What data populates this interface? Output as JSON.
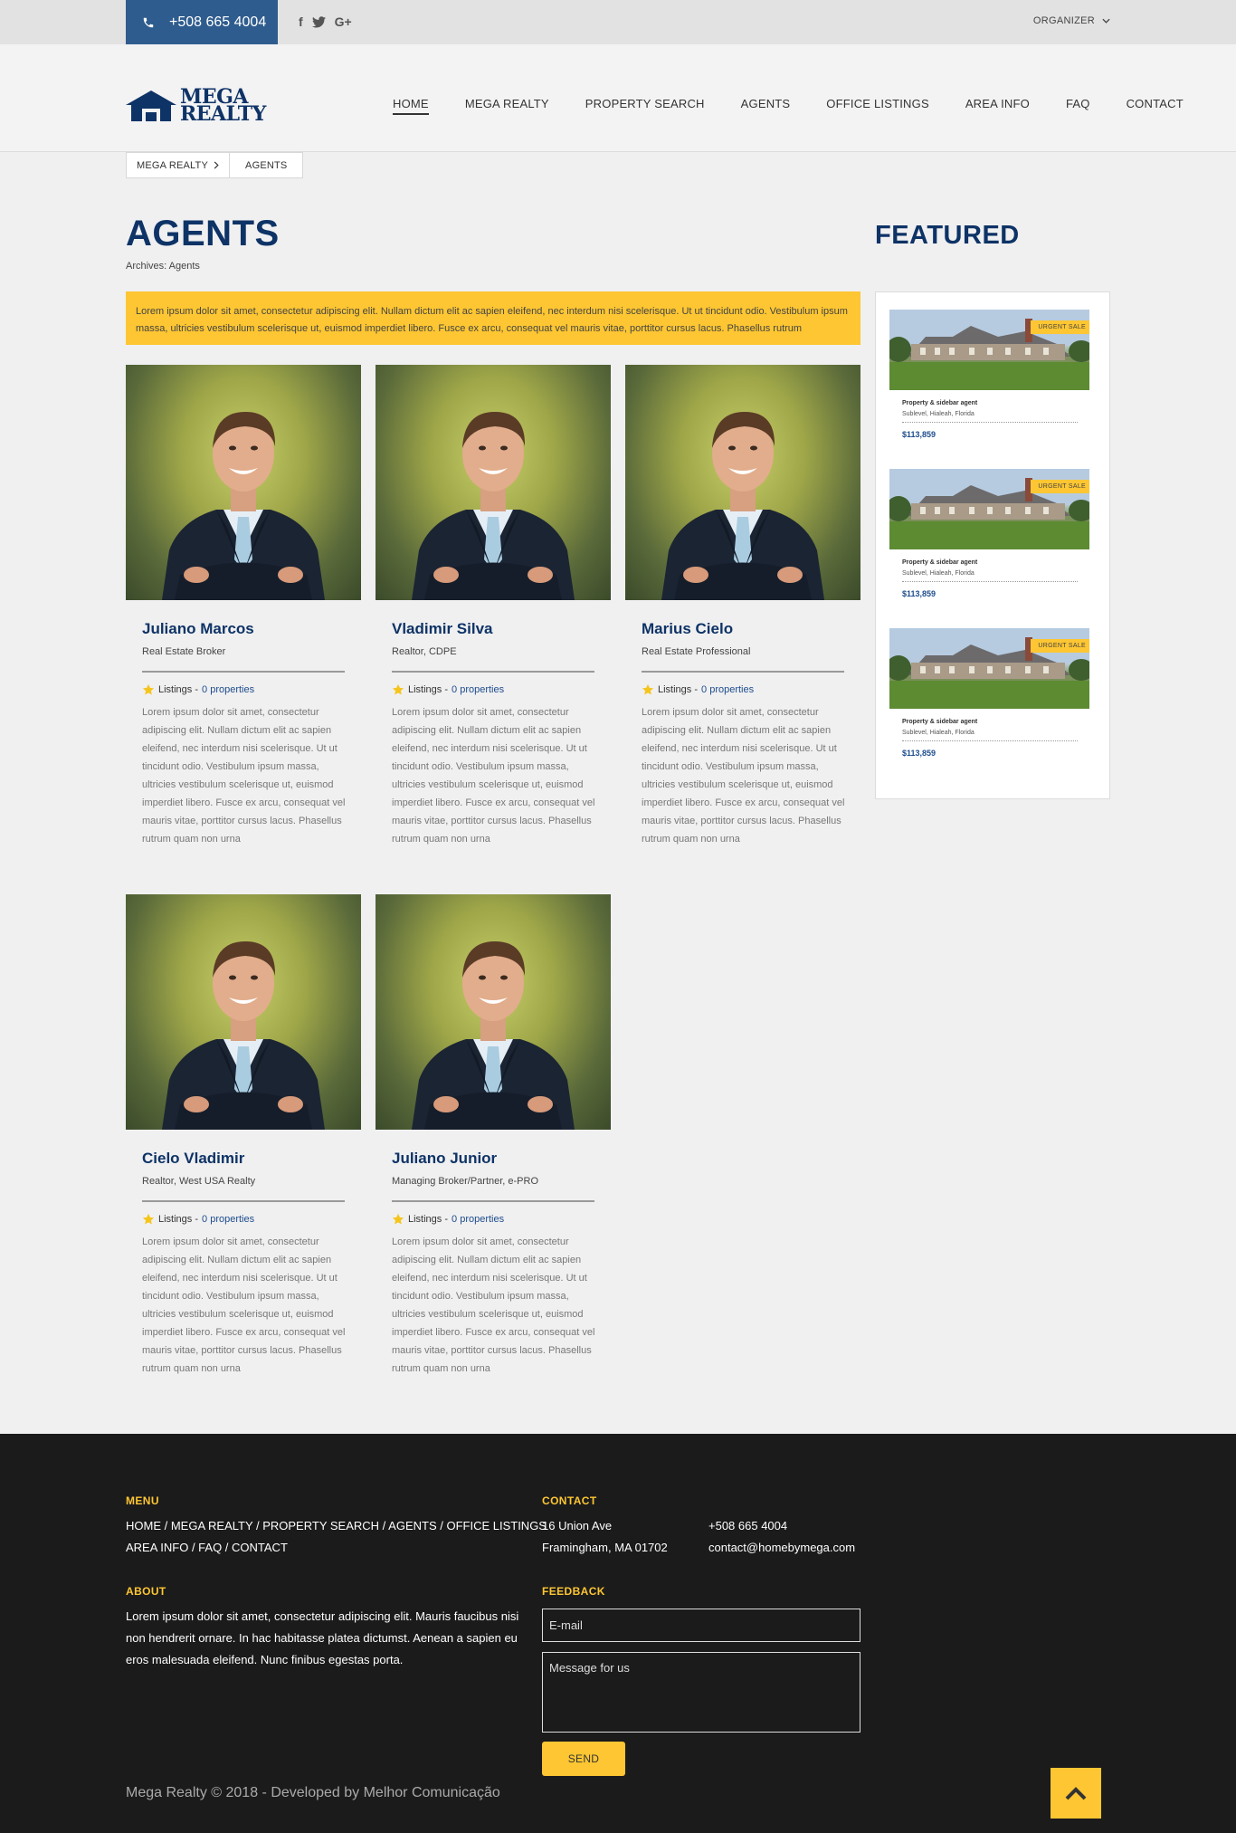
{
  "topbar": {
    "phone": "+508 665 4004",
    "social": [
      "facebook-icon",
      "twitter-icon",
      "google-plus-icon"
    ],
    "organizer": "ORGANIZER"
  },
  "logo": {
    "line1": "MEGA",
    "line2": "REALTY"
  },
  "nav": {
    "items": [
      "HOME",
      "MEGA REALTY",
      "PROPERTY SEARCH",
      "AGENTS",
      "OFFICE LISTINGS",
      "AREA INFO",
      "FAQ",
      "CONTACT"
    ],
    "active": "HOME"
  },
  "breadcrumb": [
    "MEGA REALTY",
    "AGENTS"
  ],
  "page": {
    "title": "AGENTS",
    "archives": "Archives: Agents",
    "notice": "Lorem ipsum dolor sit amet, consectetur adipiscing elit. Nullam dictum elit ac sapien eleifend, nec interdum nisi scelerisque. Ut ut tincidunt odio. Vestibulum ipsum massa, ultricies vestibulum scelerisque ut, euismod imperdiet libero. Fusce ex arcu, consequat vel mauris vitae, porttitor cursus lacus. Phasellus rutrum"
  },
  "agents": [
    {
      "name": "Juliano Marcos",
      "role": "Real Estate Broker",
      "listings_label": "Listings - ",
      "count": "0 properties",
      "desc": "Lorem ipsum dolor sit amet, consectetur adipiscing elit. Nullam dictum elit ac sapien eleifend, nec interdum nisi scelerisque. Ut ut tincidunt odio. Vestibulum ipsum massa, ultricies vestibulum scelerisque ut, euismod imperdiet libero. Fusce ex arcu, consequat vel mauris vitae, porttitor cursus lacus. Phasellus rutrum quam non urna"
    },
    {
      "name": "Vladimir Silva",
      "role": "Realtor, CDPE",
      "listings_label": "Listings - ",
      "count": "0 properties",
      "desc": "Lorem ipsum dolor sit amet, consectetur adipiscing elit. Nullam dictum elit ac sapien eleifend, nec interdum nisi scelerisque. Ut ut tincidunt odio. Vestibulum ipsum massa, ultricies vestibulum scelerisque ut, euismod imperdiet libero. Fusce ex arcu, consequat vel mauris vitae, porttitor cursus lacus. Phasellus rutrum quam non urna"
    },
    {
      "name": "Marius Cielo",
      "role": "Real Estate Professional",
      "listings_label": "Listings - ",
      "count": "0 properties",
      "desc": "Lorem ipsum dolor sit amet, consectetur adipiscing elit. Nullam dictum elit ac sapien eleifend, nec interdum nisi scelerisque. Ut ut tincidunt odio. Vestibulum ipsum massa, ultricies vestibulum scelerisque ut, euismod imperdiet libero. Fusce ex arcu, consequat vel mauris vitae, porttitor cursus lacus. Phasellus rutrum quam non urna"
    },
    {
      "name": "Cielo Vladimir",
      "role": "Realtor, West USA Realty",
      "listings_label": "Listings - ",
      "count": "0 properties",
      "desc": "Lorem ipsum dolor sit amet, consectetur adipiscing elit. Nullam dictum elit ac sapien eleifend, nec interdum nisi scelerisque. Ut ut tincidunt odio. Vestibulum ipsum massa, ultricies vestibulum scelerisque ut, euismod imperdiet libero. Fusce ex arcu, consequat vel mauris vitae, porttitor cursus lacus. Phasellus rutrum quam non urna"
    },
    {
      "name": "Juliano Junior",
      "role": "Managing Broker/Partner, e-PRO",
      "listings_label": "Listings - ",
      "count": "0 properties",
      "desc": "Lorem ipsum dolor sit amet, consectetur adipiscing elit. Nullam dictum elit ac sapien eleifend, nec interdum nisi scelerisque. Ut ut tincidunt odio. Vestibulum ipsum massa, ultricies vestibulum scelerisque ut, euismod imperdiet libero. Fusce ex arcu, consequat vel mauris vitae, porttitor cursus lacus. Phasellus rutrum quam non urna"
    }
  ],
  "sidebar": {
    "title": "FEATURED",
    "items": [
      {
        "badge": "URGENT SALE",
        "title": "Property & sidebar agent",
        "address": "Sublevel, Hialeah, Florida",
        "price": "$113,859"
      },
      {
        "badge": "URGENT SALE",
        "title": "Property & sidebar agent",
        "address": "Sublevel, Hialeah, Florida",
        "price": "$113,859"
      },
      {
        "badge": "URGENT SALE",
        "title": "Property & sidebar agent",
        "address": "Sublevel, Hialeah, Florida",
        "price": "$113,859"
      }
    ]
  },
  "footer": {
    "menu_heading": "MENU",
    "menu_line1": "HOME / MEGA REALTY / PROPERTY SEARCH / AGENTS / OFFICE LISTINGS",
    "menu_line2": "AREA INFO / FAQ / CONTACT",
    "contact_heading": "CONTACT",
    "address1": "16 Union Ave",
    "address2": "Framingham, MA 01702",
    "phone": "+508 665 4004",
    "email": "contact@homebymega.com",
    "about_heading": "ABOUT",
    "about_text": "Lorem ipsum dolor sit amet, consectetur adipiscing elit. Mauris faucibus nisi non hendrerit ornare. In hac habitasse platea dictumst. Aenean a sapien eu eros malesuada eleifend. Nunc finibus egestas porta.",
    "feedback_heading": "FEEDBACK",
    "email_placeholder": "E-mail",
    "message_placeholder": "Message for us",
    "send_label": "SEND",
    "copyright": "Mega Realty © 2018 - Developed by Melhor Comunicação"
  }
}
